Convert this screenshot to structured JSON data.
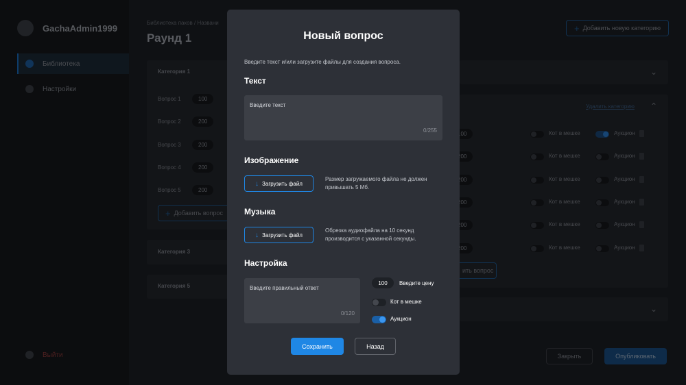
{
  "sidebar": {
    "username": "GachaAdmin1999",
    "items": [
      {
        "label": "Библиотека"
      },
      {
        "label": "Настройки"
      }
    ],
    "logout_label": "Выйти"
  },
  "header": {
    "breadcrumb": "Библиотека паков / Названи",
    "round_title": "Раунд 1",
    "add_category_label": "Добавить новую категорию"
  },
  "left_categories": [
    {
      "title": "Категория 1"
    },
    {
      "title": "Категория 3"
    },
    {
      "title": "Категория 5"
    }
  ],
  "questions": [
    {
      "label": "Вопрос 1",
      "price": "100"
    },
    {
      "label": "Вопрос 2",
      "price": "200"
    },
    {
      "label": "Вопрос 3",
      "price": "200"
    },
    {
      "label": "Вопрос 4",
      "price": "200"
    },
    {
      "label": "Вопрос 5",
      "price": "200"
    }
  ],
  "add_question_label": "Добавить вопрос",
  "add_question_label_right": "ить вопрос",
  "right_panel": {
    "delete_category_label": "Удалить категорию",
    "cat_in_bag_label": "Кот в мешке",
    "auction_label": "Аукцион",
    "prices": [
      "100",
      "200",
      "200",
      "200",
      "200",
      "200"
    ]
  },
  "footer": {
    "close_label": "Закрыть",
    "publish_label": "Опубликовать"
  },
  "modal": {
    "title": "Новый вопрос",
    "subtitle": "Введите текст и/или загрузите файлы для создания вопроса.",
    "text_heading": "Текст",
    "text_placeholder": "Введите текст",
    "text_counter": "0/255",
    "image_heading": "Изображение",
    "upload_label": "Загрузить файл",
    "image_hint": "Размер загружаемого файла не должен привышать 5 Мб.",
    "music_heading": "Музыка",
    "music_hint": "Обрезка аудиофайла на 10 секунд производится с указанной секунды.",
    "settings_heading": "Настройка",
    "answer_placeholder": "Введите правильный ответ",
    "answer_counter": "0/120",
    "price_value": "100",
    "price_label": "Введите цену",
    "cat_in_bag_label": "Кот в мешке",
    "cat_in_bag_on": false,
    "auction_label": "Аукцион",
    "auction_on": true,
    "save_label": "Сохранить",
    "back_label": "Назад"
  },
  "colors": {
    "accent": "#1f87e5",
    "modal_bg": "#2d3037",
    "input_bg": "#3c3f46",
    "danger": "#8d3a3a"
  }
}
